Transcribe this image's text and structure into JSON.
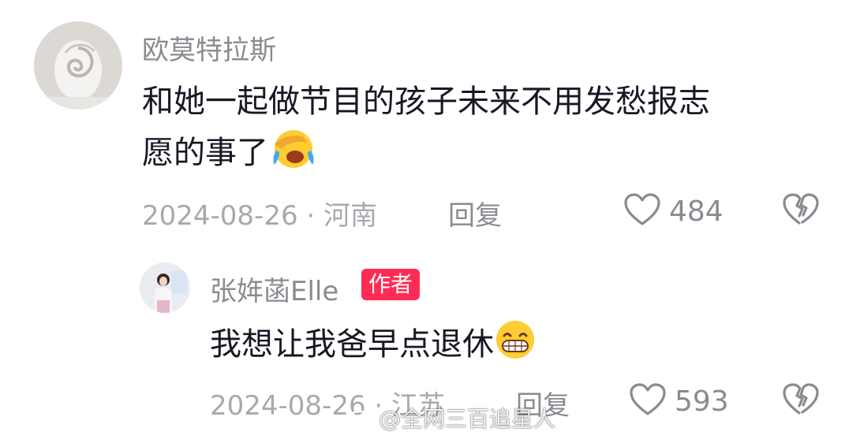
{
  "comment": {
    "author": "欧莫特拉斯",
    "text_line1": "和她一起做节目的孩子未来不用发愁报志",
    "text_line2": "愿的事了",
    "emoji": "face-with-hand-over-eyes-crying-laughing",
    "date_location": "2024-08-26 · 河南",
    "reply_label": "回复",
    "likes": "484"
  },
  "reply": {
    "author": "张姩菡Elle",
    "author_badge": "作者",
    "text": "我想让我爸早点退休",
    "emoji": "grinning-face-with-teeth",
    "date_location": "2024-08-26 · 江苏",
    "reply_label": "回复",
    "likes": "593"
  },
  "watermark": {
    "text": "@全网三百追星人",
    "icon": "weibo-logo"
  },
  "colors": {
    "badge": "#fe2c55",
    "meta": "#a8a9ae",
    "text": "#161823"
  }
}
